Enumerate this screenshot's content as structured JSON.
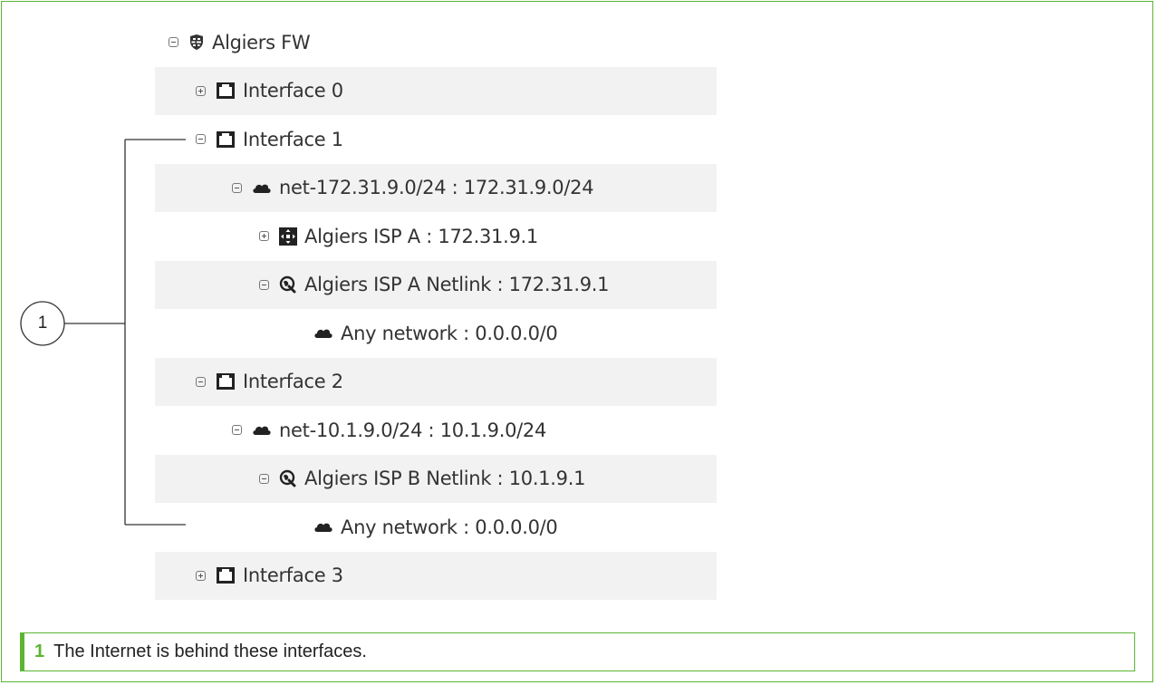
{
  "tree": {
    "rows": [
      {
        "label": "Algiers FW",
        "icon": "firewall-icon",
        "toggle": "collapse",
        "level": 0
      },
      {
        "label": "Interface 0",
        "icon": "interface-icon",
        "toggle": "expand",
        "level": 1
      },
      {
        "label": "Interface 1",
        "icon": "interface-icon",
        "toggle": "collapse",
        "level": 1
      },
      {
        "label": "net-172.31.9.0/24 : 172.31.9.0/24",
        "icon": "network-cloud-icon",
        "toggle": "collapse",
        "level": 2
      },
      {
        "label": "Algiers ISP A : 172.31.9.1",
        "icon": "router-icon",
        "toggle": "expand",
        "level": 3
      },
      {
        "label": "Algiers ISP A Netlink : 172.31.9.1",
        "icon": "netlink-icon",
        "toggle": "collapse",
        "level": 3
      },
      {
        "label": "Any network : 0.0.0.0/0",
        "icon": "network-cloud-icon",
        "toggle": "none",
        "level": 4
      },
      {
        "label": "Interface 2",
        "icon": "interface-icon",
        "toggle": "collapse",
        "level": 1
      },
      {
        "label": "net-10.1.9.0/24 : 10.1.9.0/24",
        "icon": "network-cloud-icon",
        "toggle": "collapse",
        "level": 2
      },
      {
        "label": "Algiers ISP B Netlink : 10.1.9.1",
        "icon": "netlink-icon",
        "toggle": "collapse",
        "level": 3
      },
      {
        "label": "Any network : 0.0.0.0/0",
        "icon": "network-cloud-icon",
        "toggle": "none",
        "level": 4
      },
      {
        "label": "Interface 3",
        "icon": "interface-icon",
        "toggle": "expand",
        "level": 1
      }
    ]
  },
  "callout": {
    "number": "1"
  },
  "note": {
    "number": "1",
    "text": "The Internet is behind these interfaces."
  },
  "colors": {
    "accent": "#5cb531",
    "row_shade": "#f2f2f2",
    "text": "#333333"
  }
}
